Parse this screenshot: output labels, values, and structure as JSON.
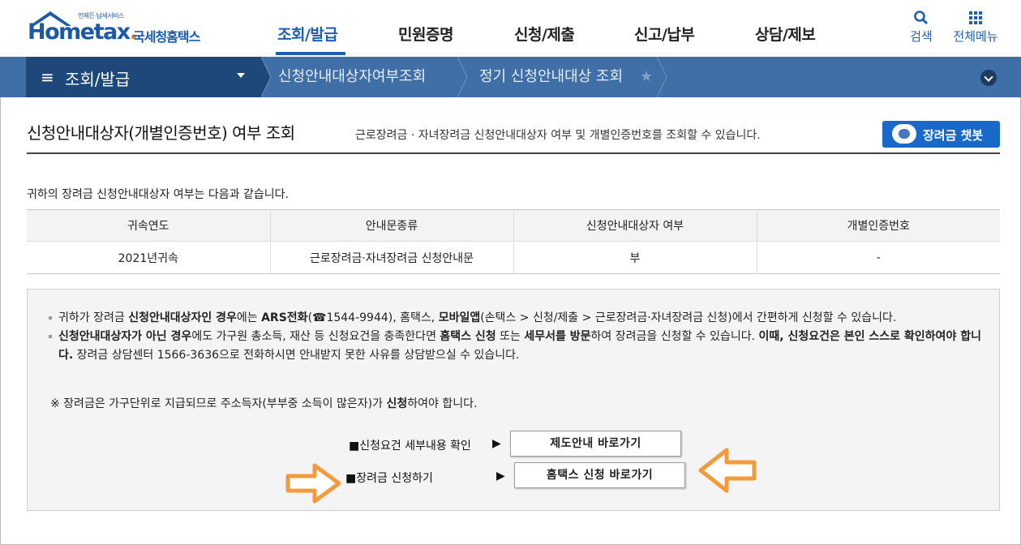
{
  "header": {
    "logo_small": "언제든 납세서비스",
    "logo_home": "Home",
    "logo_tax": "tax",
    "logo_kor": "국세청홈택스",
    "nav": [
      "조회/발급",
      "민원증명",
      "신청/제출",
      "신고/납부",
      "상담/제보"
    ],
    "search_label": "검색",
    "menu_label": "전체메뉴"
  },
  "locbar": {
    "first": "조회/발급",
    "second": "신청안내대상자여부조회",
    "third": "정기 신청안내대상 조회"
  },
  "page": {
    "title": "신청안내대상자(개별인증번호) 여부 조회",
    "subtitle": "근로장려금 · 자녀장려금 신청안내대상자 여부 및 개별인증번호를 조회할 수 있습니다.",
    "chatbot_label": "장려금 챗봇",
    "description": "귀하의 장려금 신청안내대상자 여부는 다음과 같습니다."
  },
  "table": {
    "headers": [
      "귀속연도",
      "안내문종류",
      "신청안내대상자 여부",
      "개별인증번호"
    ],
    "rows": [
      [
        "2021년귀속",
        "근로장려금·자녀장려금 신청안내문",
        "부",
        "-"
      ]
    ]
  },
  "info": {
    "b1_p1": "귀하가 장려금 ",
    "b1_b1": "신청안내대상자인 경우",
    "b1_p2": "에는 ",
    "b1_b2": "ARS전화",
    "b1_p3": "(☎1544-9944), 홈택스, ",
    "b1_b3": "모바일앱",
    "b1_p4": "(손택스 > 신청/제출 > 근로장려금·자녀장려금 신청)에서 간편하게 신청할 수 있습니다.",
    "b2_b1": "신청안내대상자가 아닌 경우",
    "b2_p1": "에도 가구원 총소득, 재산 등 신청요건을 충족한다면 ",
    "b2_b2": "홈택스 신청",
    "b2_p2": " 또는 ",
    "b2_b3": "세무서를 방문",
    "b2_p3": "하여 장려금을 신청할 수 있습니다. ",
    "b2_b4": "이때, 신청요건은 본인 스스로 확인하여야 합니다.",
    "b2_p4": " 장려금 상담센터 1566-3636으로 전화하시면 안내받지 못한 사유를 상담받으실 수 있습니다.",
    "note_p1": "※ 장려금은 가구단위로 지급되므로 주소득자(부부중 소득이 많은자)가 ",
    "note_b1": "신청",
    "note_p2": "하여야 합니다.",
    "link1_label": "■신청요건 세부내용 확인",
    "link1_button": "제도안내 바로가기",
    "link2_label": "■장려금 신청하기",
    "link2_button": "홈택스 신청 바로가기",
    "triangle": "▶"
  },
  "colors": {
    "brand_blue": "#1d5fb3",
    "locbar_bg": "#3f6fa6",
    "locbar_first_bg": "#1e4879",
    "chatbot_bg": "#1869c9",
    "arrow_orange": "#f39a3c"
  }
}
